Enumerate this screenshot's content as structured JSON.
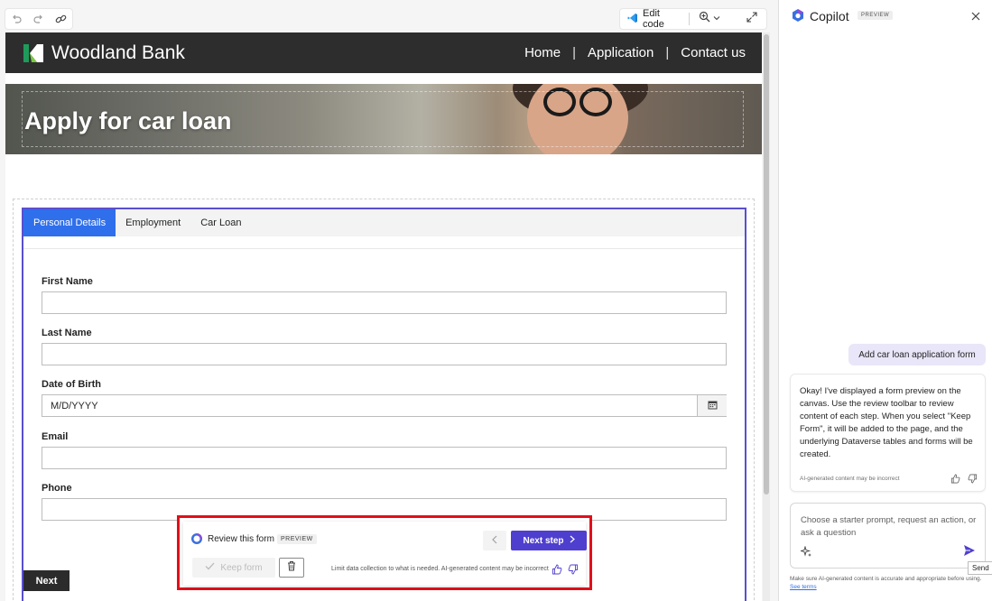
{
  "toolbar": {
    "undo_icon": "undo-icon",
    "redo_icon": "redo-icon",
    "link_icon": "link-icon",
    "edit_code_label": "Edit code",
    "zoom_icon": "zoom-icon",
    "expand_icon": "expand-icon"
  },
  "site": {
    "brand": "Woodland Bank",
    "nav": [
      "Home",
      "Application",
      "Contact us"
    ],
    "nav_separator": "|",
    "hero_title": "Apply for car loan"
  },
  "form": {
    "tabs": [
      {
        "label": "Personal Details",
        "active": true
      },
      {
        "label": "Employment",
        "active": false
      },
      {
        "label": "Car Loan",
        "active": false
      }
    ],
    "fields": [
      {
        "label": "First Name",
        "value": ""
      },
      {
        "label": "Last Name",
        "value": ""
      },
      {
        "label": "Date of Birth",
        "placeholder": "M/D/YYYY"
      },
      {
        "label": "Email",
        "value": ""
      },
      {
        "label": "Phone",
        "value": ""
      }
    ],
    "next_label": "Next"
  },
  "review": {
    "title": "Review this form",
    "badge": "PREVIEW",
    "next_step_label": "Next step",
    "keep_label": "Keep form",
    "disclaimer": "Limit data collection to what is needed. AI-generated content may be incorrect"
  },
  "copilot": {
    "title": "Copilot",
    "badge": "PREVIEW",
    "user_message": "Add car loan application form",
    "bot_message": "Okay! I've displayed a form preview on the canvas. Use the review toolbar to review content of each step. When you select \"Keep Form\", it will be added to the page, and the underlying Dataverse tables and forms will be created.",
    "bot_footer": "AI-generated content may be incorrect",
    "input_placeholder": "Choose a starter prompt, request an action, or ask a question",
    "send_tooltip": "Send",
    "footer_text": "Make sure AI-generated content is accurate and appropriate before using.",
    "footer_link": "See terms"
  },
  "colors": {
    "accent_purple": "#4f3fcf",
    "tab_active_blue": "#2f6feb",
    "review_highlight_red": "#e0101a",
    "header_dark": "#2d2d2d",
    "logo_green": "#1f9a5b"
  }
}
